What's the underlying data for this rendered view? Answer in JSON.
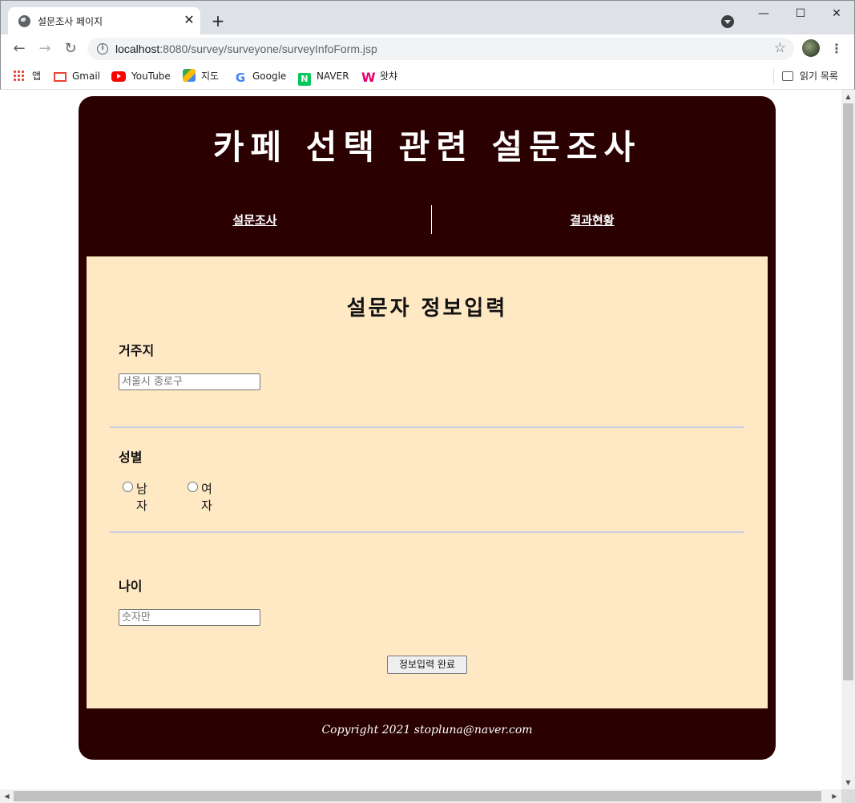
{
  "browser": {
    "tab_title": "설문조사 페이지",
    "tab_close": "✕",
    "new_tab": "+",
    "url_host": "localhost",
    "url_rest": ":8080/survey/surveyone/surveyInfoForm.jsp",
    "window_controls": {
      "minimize": "—",
      "maximize": "☐",
      "close": "✕"
    },
    "nav": {
      "back": "←",
      "forward": "→",
      "reload": "↻"
    },
    "bookmarks": [
      {
        "label": "앱",
        "icon": "apps-grid-icon"
      },
      {
        "label": "Gmail",
        "icon": "gmail-icon"
      },
      {
        "label": "YouTube",
        "icon": "youtube-icon"
      },
      {
        "label": "지도",
        "icon": "maps-icon"
      },
      {
        "label": "Google",
        "icon": "google-icon"
      },
      {
        "label": "NAVER",
        "icon": "naver-icon"
      },
      {
        "label": "왓챠",
        "icon": "watcha-icon"
      }
    ],
    "reading_list": "읽기 목록"
  },
  "page": {
    "site_title": "카페 선택 관련 설문조사",
    "nav": {
      "survey": "설문조사",
      "results": "결과현황"
    },
    "form_title": "설문자 정보입력",
    "residence": {
      "label": "거주지",
      "placeholder": "서울시 종로구",
      "value": ""
    },
    "gender": {
      "label": "성별",
      "options": [
        "남자",
        "여자"
      ]
    },
    "age": {
      "label": "나이",
      "placeholder": "숫자만",
      "value": ""
    },
    "submit": "정보입력 완료",
    "footer": "Copyright 2021 stopluna@naver.com"
  },
  "colors": {
    "header_bg": "#2a0000",
    "content_bg": "#ffe8c4",
    "divider": "#c8d0e0"
  }
}
